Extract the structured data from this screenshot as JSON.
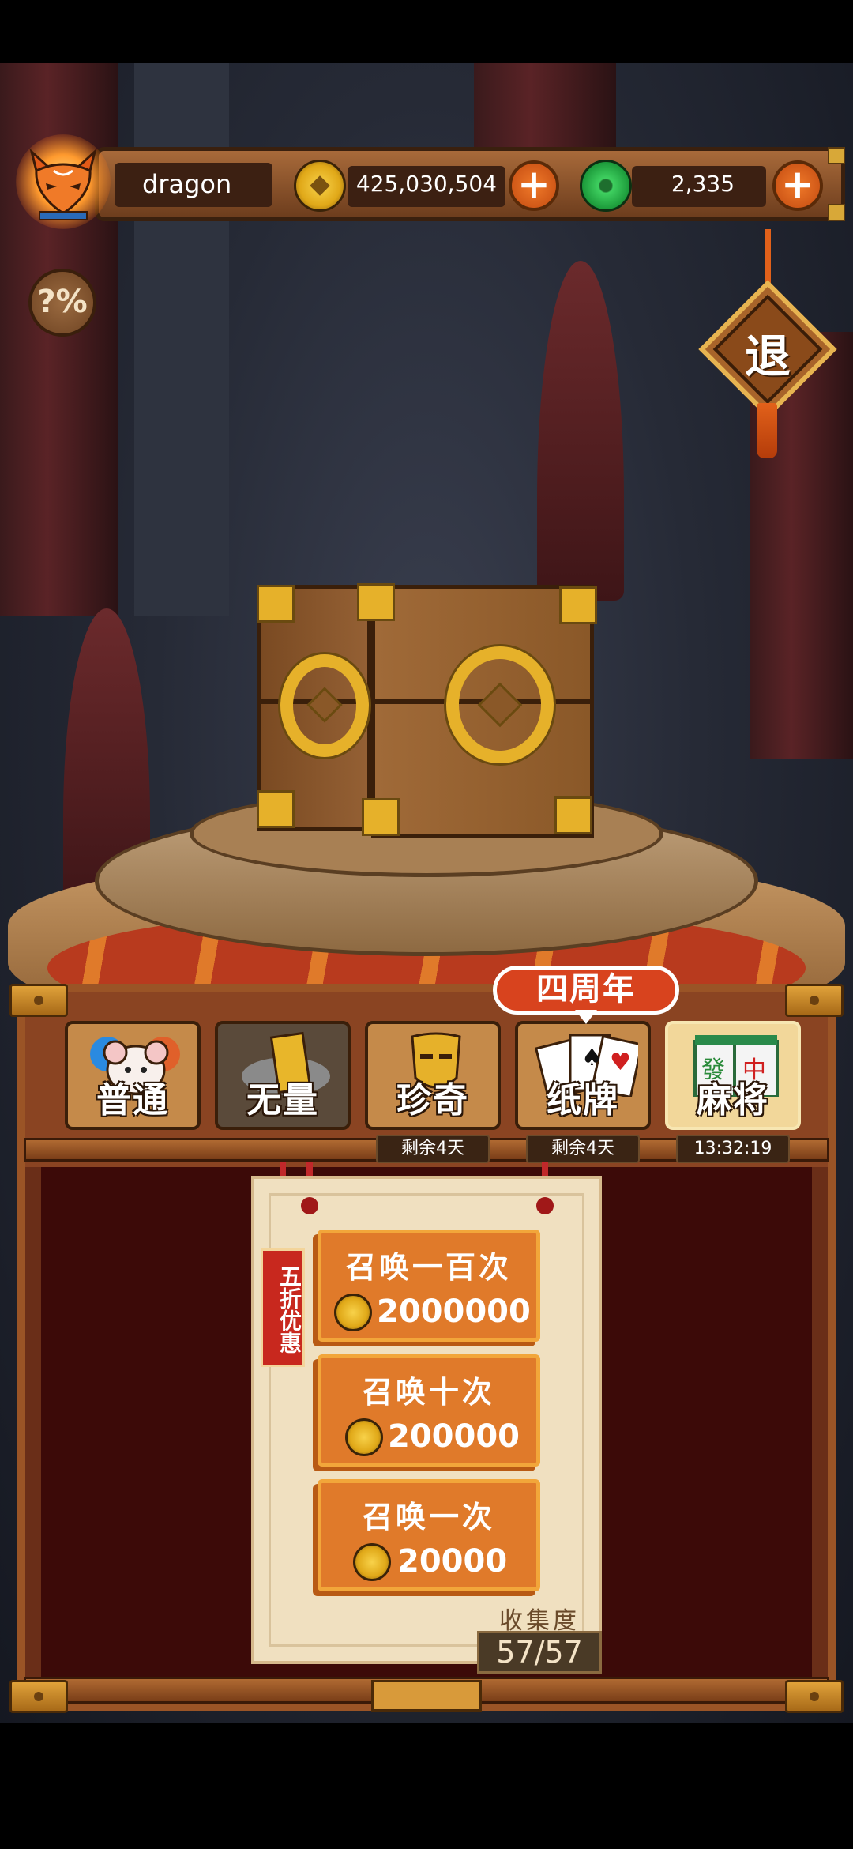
{
  "player": {
    "name": "dragon",
    "coins": "425,030,504",
    "gems": "2,335"
  },
  "buttons": {
    "plus": "+",
    "help": "?%",
    "exit": "退"
  },
  "banner": {
    "anniversary": "四周年"
  },
  "tabs": [
    {
      "label": "普通",
      "state": "normal"
    },
    {
      "label": "无量",
      "state": "locked"
    },
    {
      "label": "珍奇",
      "state": "normal",
      "tag": "剩余4天"
    },
    {
      "label": "纸牌",
      "state": "normal",
      "tag": "剩余4天"
    },
    {
      "label": "麻将",
      "state": "selected",
      "tag": "13:32:19"
    }
  ],
  "promo": {
    "tag": "五折优惠"
  },
  "summon": [
    {
      "title": "召唤一百次",
      "cost": "2000000"
    },
    {
      "title": "召唤十次",
      "cost": "200000"
    },
    {
      "title": "召唤一次",
      "cost": "20000"
    }
  ],
  "collection": {
    "label": "收集度",
    "value": "57/57"
  },
  "colors": {
    "accent": "#e07a2a",
    "gold": "#e6b12a",
    "panel": "#3c0a08"
  }
}
